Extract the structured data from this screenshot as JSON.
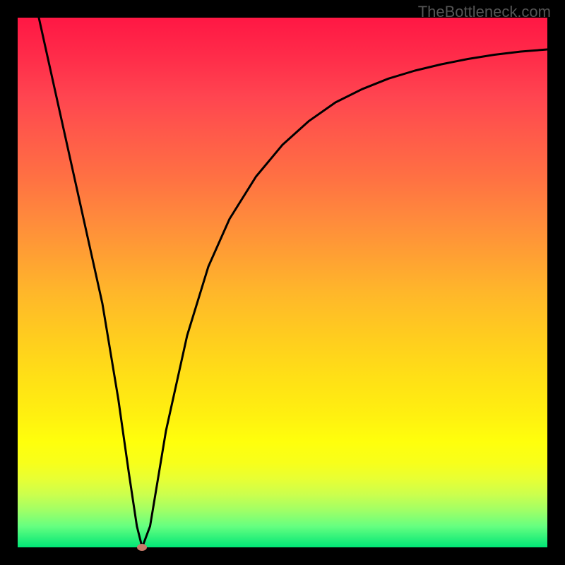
{
  "watermark": "TheBottleneck.com",
  "chart_data": {
    "type": "line",
    "title": "",
    "xlabel": "",
    "ylabel": "",
    "xlim": [
      0,
      100
    ],
    "ylim": [
      0,
      100
    ],
    "series": [
      {
        "name": "curve",
        "x": [
          4,
          8,
          12,
          16,
          19,
          21,
          22.5,
          23.5,
          25,
          28,
          32,
          36,
          40,
          45,
          50,
          55,
          60,
          65,
          70,
          75,
          80,
          85,
          90,
          95,
          100
        ],
        "y": [
          100,
          82,
          64,
          46,
          28,
          14,
          4,
          0,
          4,
          22,
          40,
          53,
          62,
          70,
          76,
          80.5,
          84,
          86.5,
          88.5,
          90,
          91.2,
          92.2,
          93,
          93.6,
          94
        ]
      }
    ],
    "marker": {
      "x": 23.5,
      "y": 0,
      "color": "#c77a6a"
    },
    "gradient_colors": {
      "top": "#ff1744",
      "mid_upper": "#ff8a3c",
      "mid": "#ffe016",
      "mid_lower": "#ccff4d",
      "bottom": "#00e676"
    }
  }
}
